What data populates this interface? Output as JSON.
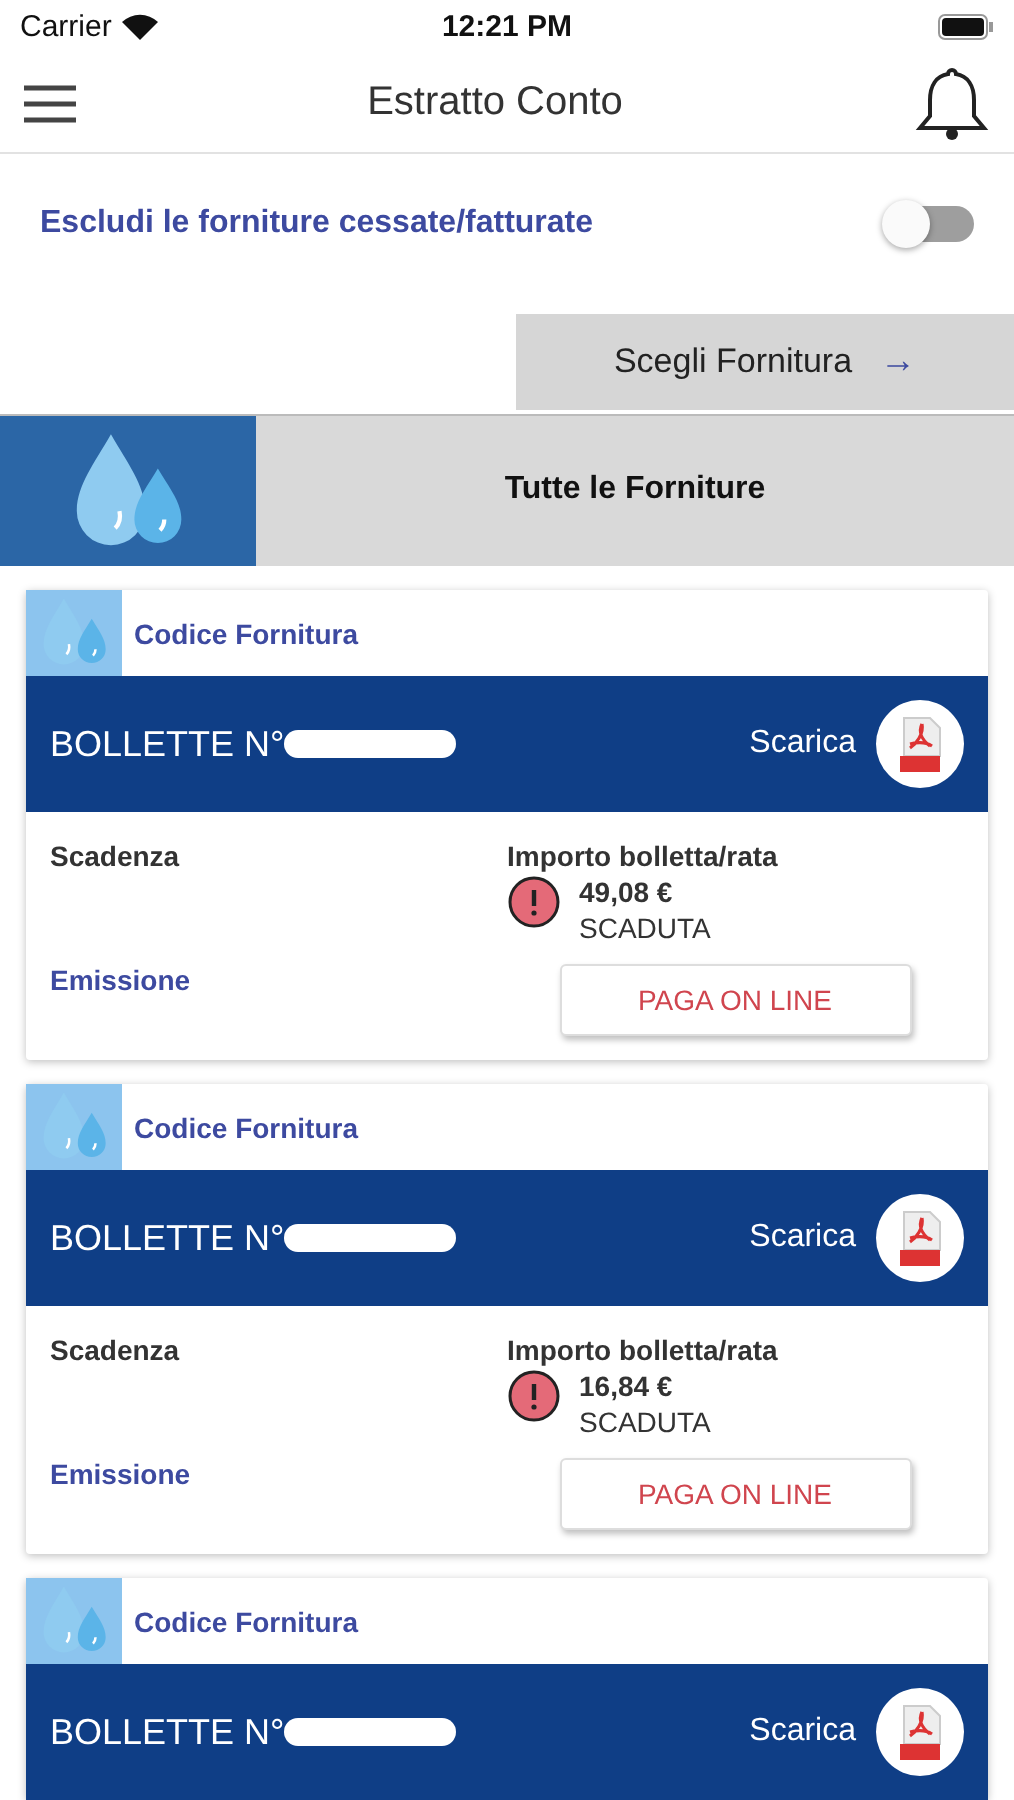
{
  "status_bar": {
    "carrier": "Carrier",
    "time": "12:21 PM"
  },
  "header": {
    "title": "Estratto Conto"
  },
  "filter": {
    "label": "Escludi le forniture cessate/fatturate",
    "on": false
  },
  "choose_button": {
    "label": "Scegli Fornitura",
    "arrow": "→"
  },
  "supply_banner": {
    "label": "Tutte le Forniture"
  },
  "bills": [
    {
      "code_label": "Codice Fornitura",
      "title": "BOLLETTE N°",
      "download": "Scarica",
      "due_label": "Scadenza",
      "amount_label": "Importo bolletta/rata",
      "amount": "49,08 €",
      "status": "SCADUTA",
      "overdue": true,
      "issue_label": "Emissione",
      "pay_button": "PAGA ON LINE"
    },
    {
      "code_label": "Codice Fornitura",
      "title": "BOLLETTE N°",
      "download": "Scarica",
      "due_label": "Scadenza",
      "amount_label": "Importo bolletta/rata",
      "amount": "16,84 €",
      "status": "SCADUTA",
      "overdue": true,
      "issue_label": "Emissione",
      "pay_button": "PAGA ON LINE"
    },
    {
      "code_label": "Codice Fornitura",
      "title": "BOLLETTE N°",
      "download": "Scarica"
    }
  ]
}
